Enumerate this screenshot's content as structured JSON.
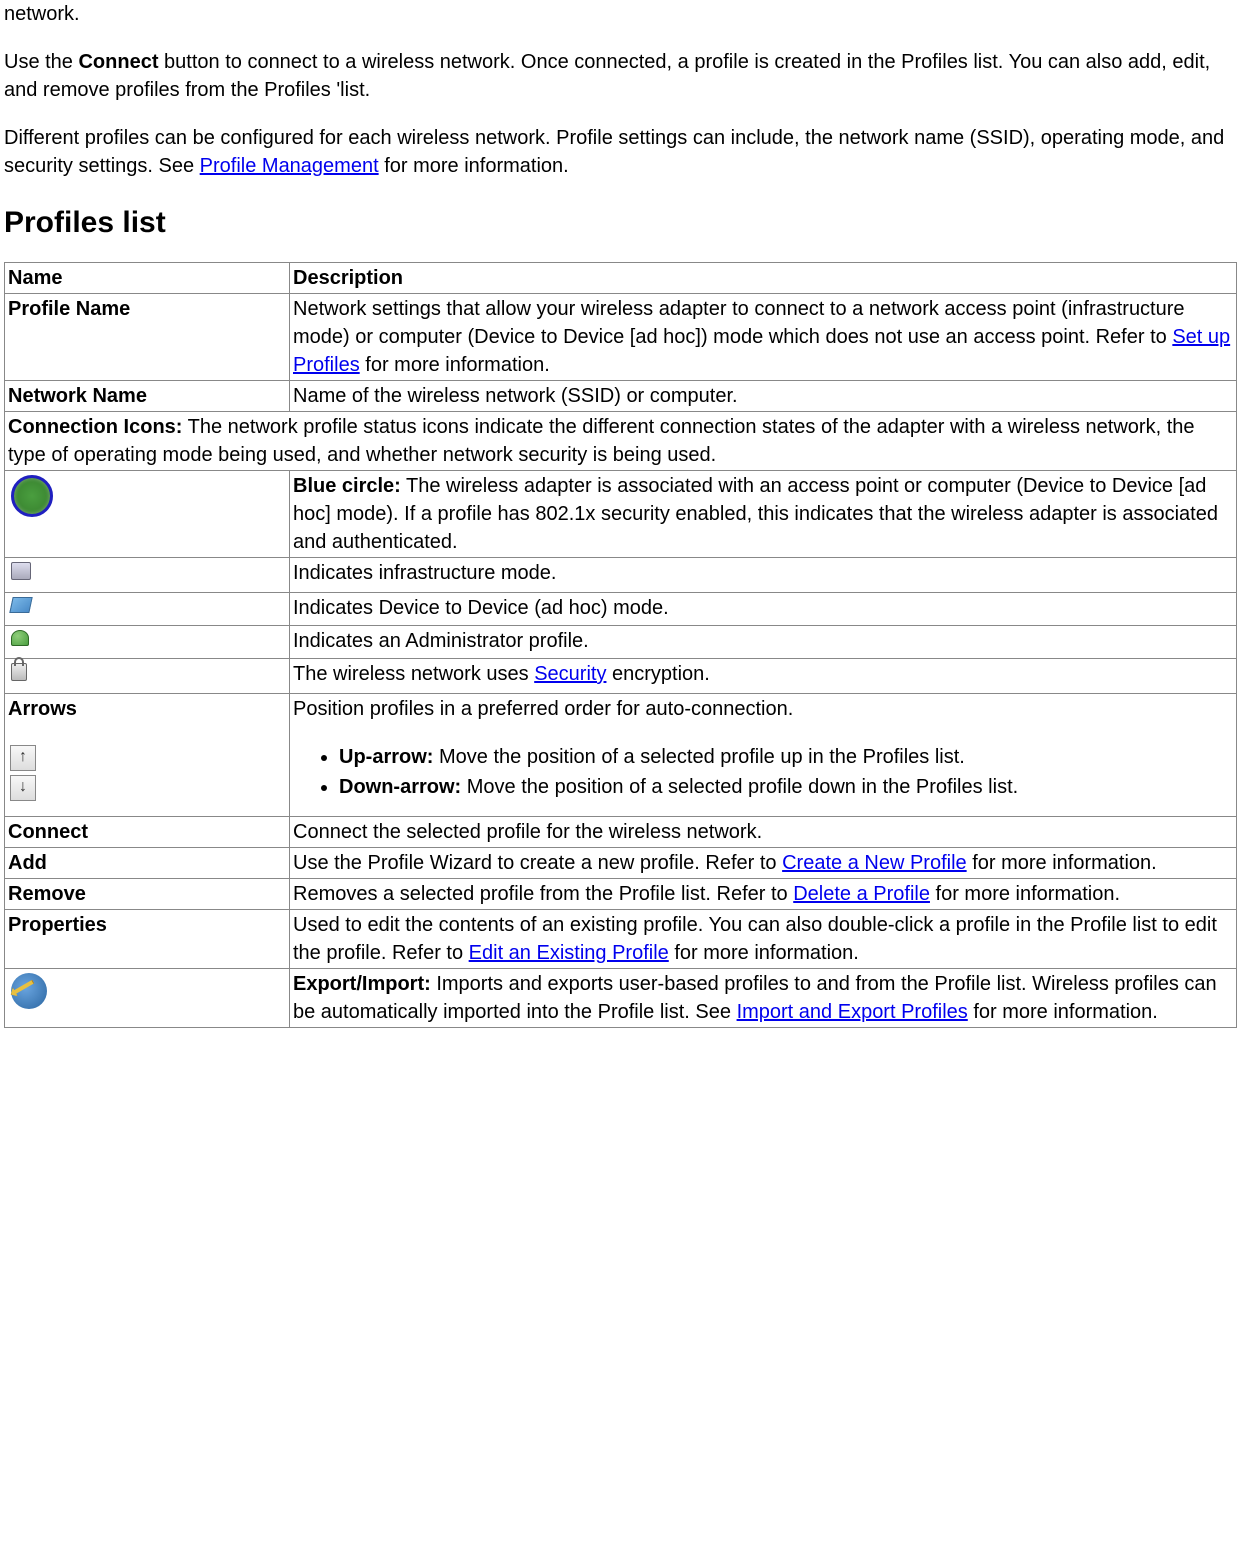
{
  "intro": {
    "p1": "network.",
    "p2_before": "Use the ",
    "p2_bold": "Connect",
    "p2_after": " button to connect to a wireless network. Once connected, a profile is created in the Profiles list. You can also add, edit, and remove profiles from the Profiles 'list.",
    "p3_before": "Different profiles can be configured for each wireless network. Profile settings can include, the network name (SSID), operating mode, and security settings. See ",
    "p3_link": "Profile Management",
    "p3_after": " for more information."
  },
  "heading": "Profiles list",
  "table": {
    "header": {
      "name": "Name",
      "desc": "Description"
    },
    "rows": {
      "profileName": {
        "name": "Profile Name",
        "desc_before": "Network settings that allow your wireless adapter to connect to a network access point (infrastructure mode) or computer (Device to Device [ad hoc]) mode which does not use an access point. Refer to ",
        "link": "Set up Profiles",
        "desc_after": " for more information."
      },
      "networkName": {
        "name": "Network Name",
        "desc": "Name of the wireless network (SSID) or computer."
      },
      "connIcons": {
        "bold": "Connection Icons:",
        "text": " The network profile status icons indicate the different connection states of the adapter with a wireless network, the type of operating mode being used, and whether network security is being used."
      },
      "blueCircle": {
        "bold": "Blue circle:",
        "text": " The wireless adapter is associated with an access point or computer (Device to Device [ad hoc] mode). If a profile has 802.1x security enabled, this indicates that the wireless adapter is associated and authenticated."
      },
      "infra": {
        "text": "Indicates infrastructure mode."
      },
      "adhoc": {
        "text": "Indicates Device to Device (ad hoc) mode."
      },
      "admin": {
        "text": "Indicates an Administrator profile."
      },
      "security": {
        "before": "The wireless network uses ",
        "link": "Security",
        "after": " encryption."
      },
      "arrows": {
        "name": "Arrows",
        "intro": "Position profiles in a preferred order for auto-connection.",
        "up_bold": "Up-arrow:",
        "up_text": " Move the position of a selected profile up in the Profiles list.",
        "down_bold": "Down-arrow:",
        "down_text": " Move the position of a selected profile down in the Profiles list."
      },
      "connect": {
        "name": "Connect",
        "desc": "Connect the selected profile for the wireless network."
      },
      "add": {
        "name": "Add",
        "before": "Use the Profile Wizard to create a new profile. Refer to ",
        "link": "Create a New Profile",
        "after": " for more information."
      },
      "remove": {
        "name": "Remove",
        "before": "Removes a selected profile from the Profile list. Refer to ",
        "link": "Delete a Profile",
        "after": " for more information."
      },
      "properties": {
        "name": "Properties",
        "before": "Used to edit the contents of an existing profile. You can also double-click a profile in the Profile list to edit the profile. Refer to ",
        "link": "Edit an Existing Profile",
        "after": " for more information."
      },
      "export": {
        "bold": "Export/Import:",
        "before": " Imports and exports user-based profiles to and from the Profile list.  Wireless profiles can be automatically imported into the Profile list. See ",
        "link": "Import and Export Profiles",
        "after": " for more information."
      }
    }
  }
}
